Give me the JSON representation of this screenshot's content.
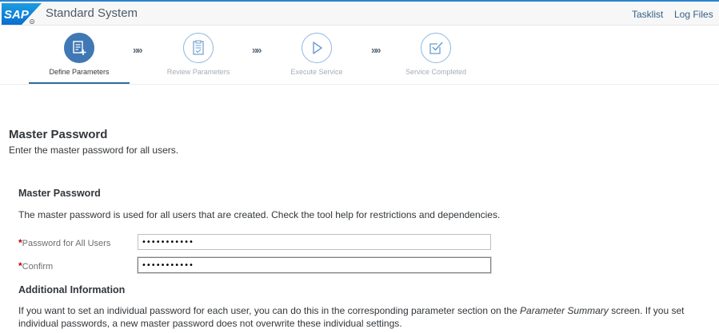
{
  "shell": {
    "title": "Standard System",
    "links": {
      "tasklist": "Tasklist",
      "log_files": "Log Files"
    }
  },
  "wizard": {
    "separator": "»»",
    "steps": [
      {
        "label": "Define Parameters",
        "icon": "edit-list-icon",
        "active": true
      },
      {
        "label": "Review Parameters",
        "icon": "clipboard-check-icon",
        "active": false
      },
      {
        "label": "Execute Service",
        "icon": "play-icon",
        "active": false
      },
      {
        "label": "Service Completed",
        "icon": "checkbox-check-icon",
        "active": false
      }
    ]
  },
  "section": {
    "title": "Master Password",
    "subtitle": "Enter the master password for all users."
  },
  "master": {
    "title": "Master Password",
    "description": "The master password is used for all users that are created. Check the tool help for restrictions and dependencies."
  },
  "fields": {
    "required_marker": "*",
    "password": {
      "label": "Password for All Users",
      "value": "•••••••••••"
    },
    "confirm": {
      "label": "Confirm",
      "value": "•••••••••••"
    }
  },
  "additional": {
    "title": "Additional Information",
    "text_before": "If you want to set an individual password for each user, you can do this in the corresponding parameter section on the ",
    "text_emphasis": "Parameter Summary",
    "text_after": " screen. If you set individual passwords, a new master password does not overwrite these individual settings."
  },
  "colors": {
    "accent": "#2a83cf",
    "active_step": "#3f78b4",
    "required": "#bb0000",
    "link": "#346187"
  }
}
